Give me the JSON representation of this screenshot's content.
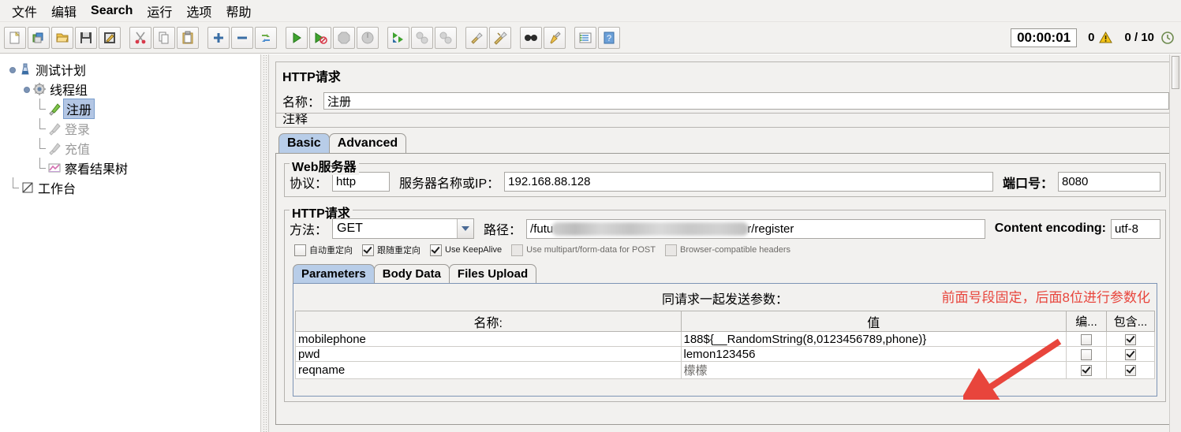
{
  "menu": {
    "items": [
      {
        "label": "文件",
        "latin": false
      },
      {
        "label": "编辑",
        "latin": false
      },
      {
        "label": "Search",
        "latin": true
      },
      {
        "label": "运行",
        "latin": false
      },
      {
        "label": "选项",
        "latin": false
      },
      {
        "label": "帮助",
        "latin": false
      }
    ]
  },
  "toolbar": {
    "buttons": [
      {
        "name": "new-icon"
      },
      {
        "name": "templates-icon"
      },
      {
        "name": "open-icon"
      },
      {
        "name": "save-icon"
      },
      {
        "name": "save-as-icon"
      },
      {
        "name": "cut-icon"
      },
      {
        "name": "copy-icon"
      },
      {
        "name": "paste-icon"
      },
      {
        "name": "expand-icon"
      },
      {
        "name": "collapse-icon"
      },
      {
        "name": "toggle-icon"
      },
      {
        "name": "start-icon"
      },
      {
        "name": "start-no-pauses-icon"
      },
      {
        "name": "stop-icon"
      },
      {
        "name": "shutdown-icon"
      },
      {
        "name": "remote-start-all-icon"
      },
      {
        "name": "remote-stop-all-icon"
      },
      {
        "name": "remote-shutdown-all-icon"
      },
      {
        "name": "clear-icon"
      },
      {
        "name": "clear-all-icon"
      },
      {
        "name": "search-icon"
      },
      {
        "name": "search-reset-icon"
      },
      {
        "name": "function-helper-icon"
      },
      {
        "name": "help-icon"
      }
    ],
    "status": {
      "elapsed_time": "00:00:01",
      "warning_count": "0",
      "thread_count": "0 / 10"
    }
  },
  "tree": {
    "nodes": [
      {
        "label": "测试计划",
        "icon": "test-plan-icon",
        "state": "normal"
      },
      {
        "label": "线程组",
        "icon": "thread-group-icon",
        "state": "normal"
      },
      {
        "label": "注册",
        "icon": "http-sampler-icon",
        "state": "selected"
      },
      {
        "label": "登录",
        "icon": "http-sampler-disabled-icon",
        "state": "disabled"
      },
      {
        "label": "充值",
        "icon": "http-sampler-disabled-icon",
        "state": "disabled"
      },
      {
        "label": "察看结果树",
        "icon": "view-results-tree-icon",
        "state": "normal"
      },
      {
        "label": "工作台",
        "icon": "workbench-icon",
        "state": "normal"
      }
    ]
  },
  "editor": {
    "title": "HTTP请求",
    "name_label": "名称：",
    "name_value": "注册",
    "comment_label": "注释",
    "tabs": [
      {
        "label": "Basic",
        "active": true
      },
      {
        "label": "Advanced",
        "active": false
      }
    ],
    "web_server": {
      "legend": "Web服务器",
      "protocol_label": "协议：",
      "protocol_value": "http",
      "server_label": "服务器名称或IP：",
      "server_value": "192.168.88.128",
      "port_label": "端口号：",
      "port_value": "8080"
    },
    "http_request": {
      "legend": "HTTP请求",
      "method_label": "方法：",
      "method_value": "GET",
      "path_label": "路径：",
      "path_prefix": "/futu",
      "path_suffix": "r/register",
      "content_encoding_label": "Content encoding:",
      "content_encoding_value": "utf-8",
      "checkboxes": [
        {
          "label": "自动重定向",
          "checked": false,
          "disabled": false
        },
        {
          "label": "跟随重定向",
          "checked": true,
          "disabled": false
        },
        {
          "label": "Use KeepAlive",
          "checked": true,
          "disabled": false
        },
        {
          "label": "Use multipart/form-data for POST",
          "checked": false,
          "disabled": true
        },
        {
          "label": "Browser-compatible headers",
          "checked": false,
          "disabled": true
        }
      ]
    },
    "param_tabs": [
      {
        "label": "Parameters",
        "active": true
      },
      {
        "label": "Body Data",
        "active": false
      },
      {
        "label": "Files Upload",
        "active": false
      }
    ],
    "params": {
      "title": "同请求一起发送参数：",
      "annotation": "前面号段固定，后面8位进行参数化",
      "columns": [
        "名称:",
        "值",
        "编...",
        "包含..."
      ],
      "rows": [
        {
          "name": "mobilephone",
          "value": "188${__RandomString(8,0123456789,phone)}",
          "encode": false,
          "include": true,
          "gray": false
        },
        {
          "name": "pwd",
          "value": "lemon123456",
          "encode": false,
          "include": true,
          "gray": false
        },
        {
          "name": "reqname",
          "value": "檬檬",
          "encode": true,
          "include": true,
          "gray": true
        }
      ]
    }
  },
  "colors": {
    "accent": "#b8cde8",
    "annotation": "#e8453c",
    "panel": "#f2f1ef"
  }
}
